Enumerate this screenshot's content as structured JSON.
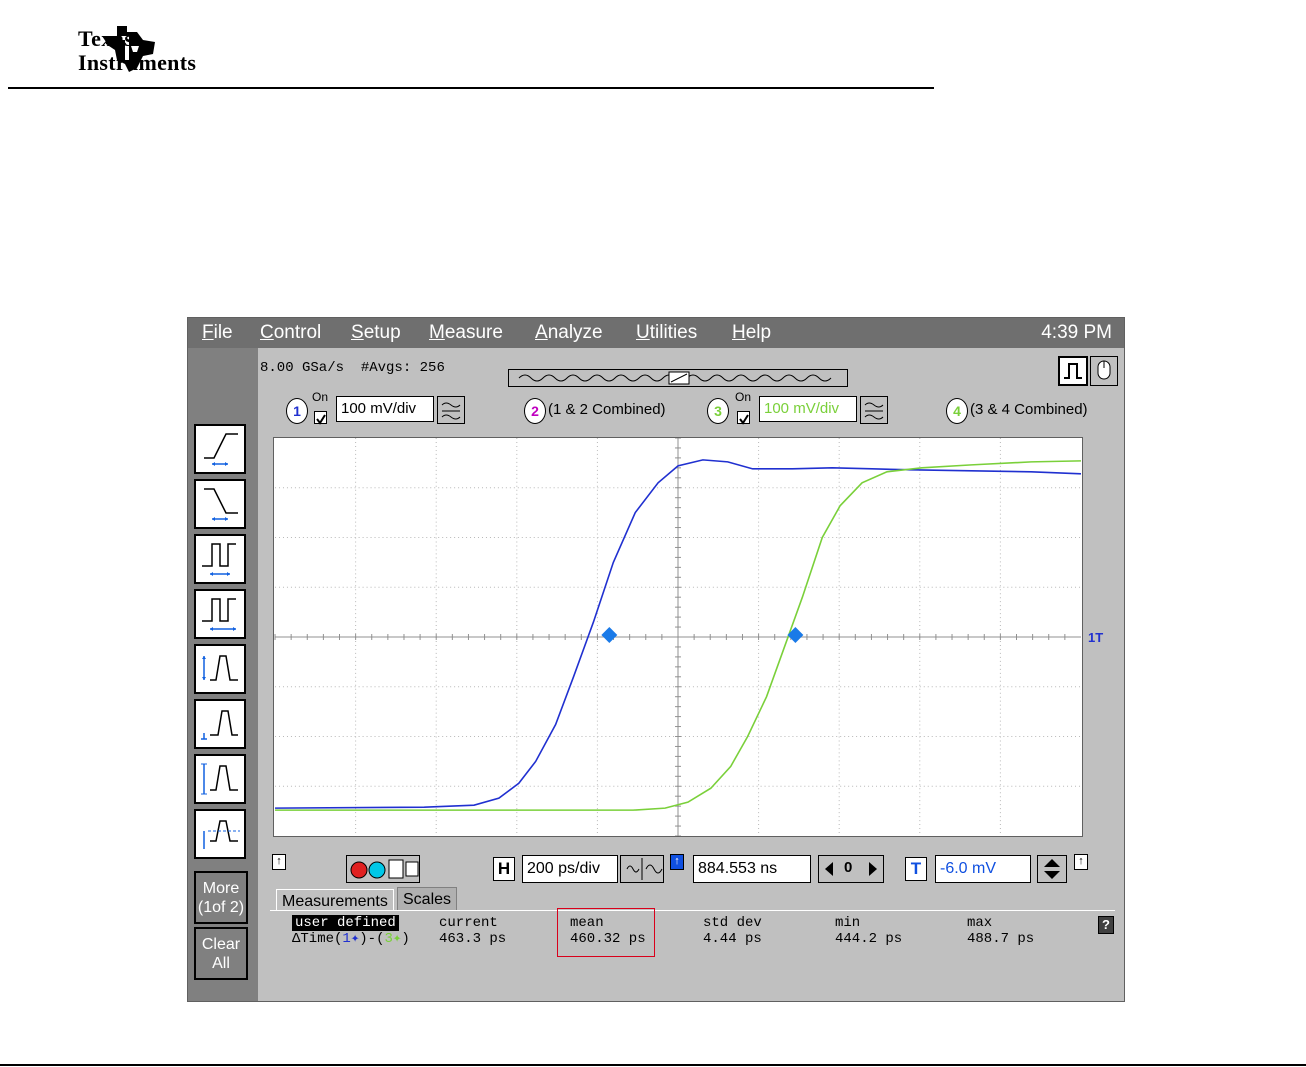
{
  "header": {
    "company_line1": "Texas",
    "company_line2": "Instruments"
  },
  "menubar": {
    "items": [
      {
        "underline": "F",
        "rest": "ile"
      },
      {
        "underline": "C",
        "rest": "ontrol"
      },
      {
        "underline": "S",
        "rest": "etup"
      },
      {
        "underline": "M",
        "rest": "easure"
      },
      {
        "underline": "A",
        "rest": "nalyze"
      },
      {
        "underline": "U",
        "rest": "tilities"
      },
      {
        "underline": "H",
        "rest": "elp"
      }
    ],
    "clock": "4:39 PM"
  },
  "status": {
    "sample_rate": "8.00 GSa/s",
    "averages": "#Avgs: 256"
  },
  "channels": {
    "ch1": {
      "num": "1",
      "on_label": "On",
      "scale": "100 mV/div",
      "color": "#2030d0"
    },
    "ch2": {
      "num": "2",
      "label": "(1 & 2 Combined)",
      "color": "#c000c0"
    },
    "ch3": {
      "num": "3",
      "on_label": "On",
      "scale": "100 mV/div",
      "color": "#7ad03a"
    },
    "ch4": {
      "num": "4",
      "label": "(3 & 4 Combined)",
      "color": "#7ad03a"
    }
  },
  "trigger_marker": "1T",
  "controls": {
    "h_label": "H",
    "timebase": "200 ps/div",
    "delay": "884.553 ns",
    "delay_step": "0",
    "t_label": "T",
    "trigger_level": "-6.0 mV"
  },
  "side_buttons": {
    "more_line1": "More",
    "more_line2": "(1of 2)",
    "clear_line1": "Clear",
    "clear_line2": "All"
  },
  "tabs": {
    "measurements": "Measurements",
    "scales": "Scales"
  },
  "measurements": {
    "name": "user defined",
    "delta_prefix": "ΔTime(",
    "delta_src1": "1",
    "delta_mid": ")-(",
    "delta_src2": "3",
    "delta_suffix": ")",
    "current_label": "current",
    "current": "463.3 ps",
    "mean_label": "mean",
    "mean": "460.32 ps",
    "stddev_label": "std dev",
    "stddev": "4.44 ps",
    "min_label": "min",
    "min": "444.2 ps",
    "max_label": "max",
    "max": "488.7 ps"
  },
  "help_glyph": "?"
}
